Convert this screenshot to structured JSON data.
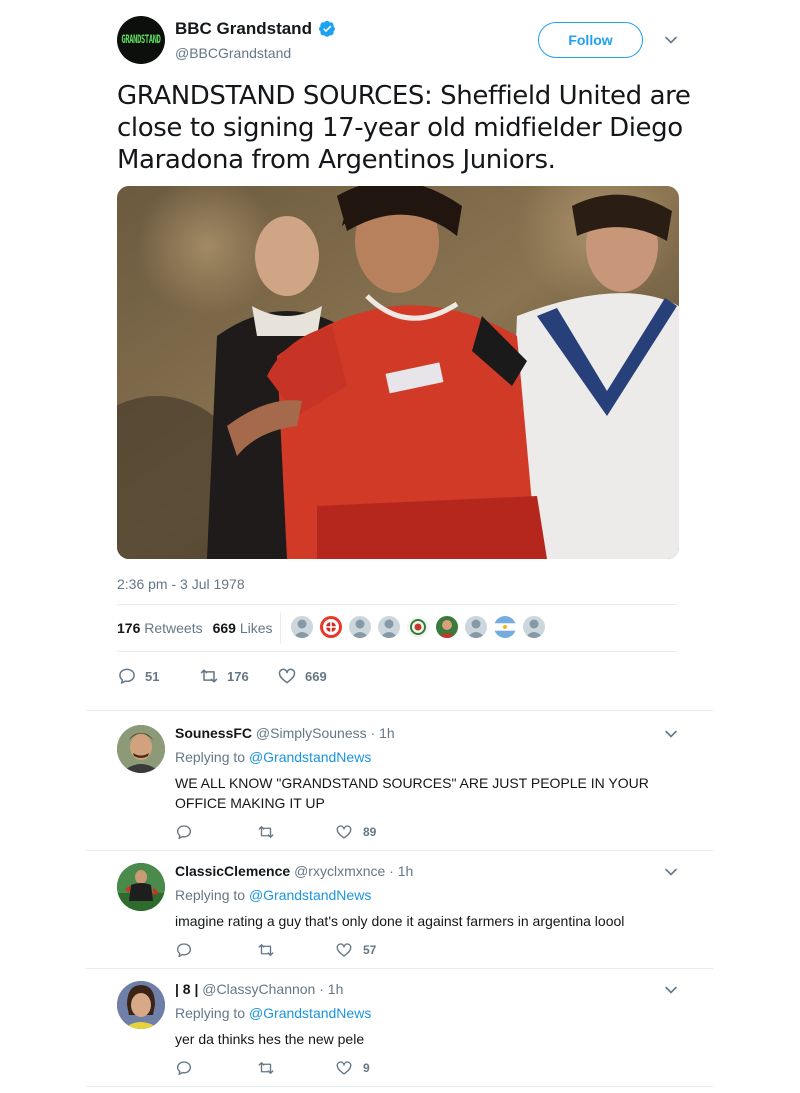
{
  "account": {
    "display_name": "BBC Grandstand",
    "handle": "@BBCGrandstand",
    "avatar_text": "GRANDSTAND",
    "follow_label": "Follow"
  },
  "tweet": {
    "text": "GRANDSTAND SOURCES: Sheffield United are close to signing 17-year old midfielder Diego Maradona from Argentinos Juniors.",
    "timestamp": "2:36 pm - 3 Jul 1978",
    "retweets_count": "176",
    "retweets_label": "Retweets",
    "likes_count": "669",
    "likes_label": "Likes",
    "actions": {
      "reply_count": "51",
      "retweet_count": "176",
      "like_count": "669"
    }
  },
  "replies": [
    {
      "name": "SounessFC",
      "handle": "@SimplySouness",
      "time": "1h",
      "replying_prefix": "Replying to",
      "replying_to": "@GrandstandNews",
      "text": "WE ALL KNOW \"GRANDSTAND SOURCES\" ARE JUST PEOPLE IN YOUR OFFICE MAKING IT UP",
      "reply_count": "",
      "retweet_count": "",
      "like_count": "89"
    },
    {
      "name": "ClassicClemence",
      "handle": "@rxyclxmxnce",
      "time": "1h",
      "replying_prefix": "Replying to",
      "replying_to": "@GrandstandNews",
      "text": "imagine rating a guy that's only done it against farmers in argentina loool",
      "reply_count": "",
      "retweet_count": "",
      "like_count": "57"
    },
    {
      "name": "| 8 |",
      "handle": "@ClassyChannon",
      "time": "1h",
      "replying_prefix": "Replying to",
      "replying_to": "@GrandstandNews",
      "text": "yer da thinks hes the new pele",
      "reply_count": "",
      "retweet_count": "",
      "like_count": "9"
    }
  ],
  "colors": {
    "accent": "#1da1f2",
    "link": "#1b95e0",
    "muted": "#657786",
    "text": "#14171a",
    "divider": "#e6ecf0"
  },
  "icons": [
    "verified-icon",
    "chevron-down-icon",
    "reply-icon",
    "retweet-icon",
    "like-icon"
  ]
}
